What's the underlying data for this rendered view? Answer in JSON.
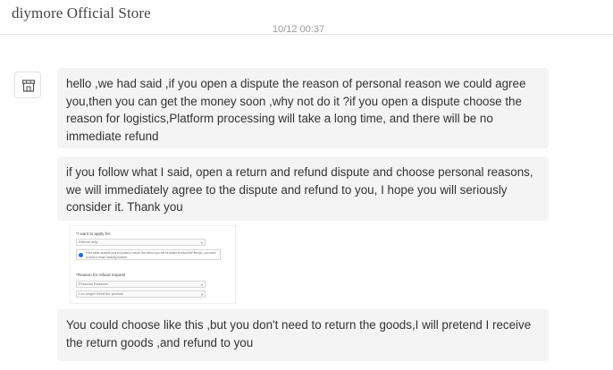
{
  "header": {
    "store_name": "diymore Official Store",
    "timestamp": "10/12 00:37"
  },
  "conversation": {
    "messages": [
      {
        "text": "hello ,we had said ,if you open a dispute the reason of personal reason we could agree you,then you can get the money soon ,why not do it ?if you open a dispute choose the reason for logistics,Platform processing will take a long time, and there will be no immediate refund"
      },
      {
        "text": "if you follow what I said, open a return and refund dispute and choose personal reasons, we will immediately agree to the dispute and refund to you, I hope you will seriously consider it. Thank you"
      },
      {
        "image": {
          "apply_label": "*I want to apply for:",
          "apply_value": "Refund only",
          "notice": "If the seller accepts your proposal or return, the refund you will be asked to return the item(s), you need to send a return tracking number.",
          "reason_label": "*Reason for refund request",
          "reason_value": "Personal Reasons",
          "detail_value": "I no longer need the product"
        }
      },
      {
        "text": "You could choose like this ,but you don't need to return the goods,I will pretend I receive the return goods ,and refund to you"
      }
    ]
  },
  "icons": {
    "avatar": "store-icon"
  }
}
